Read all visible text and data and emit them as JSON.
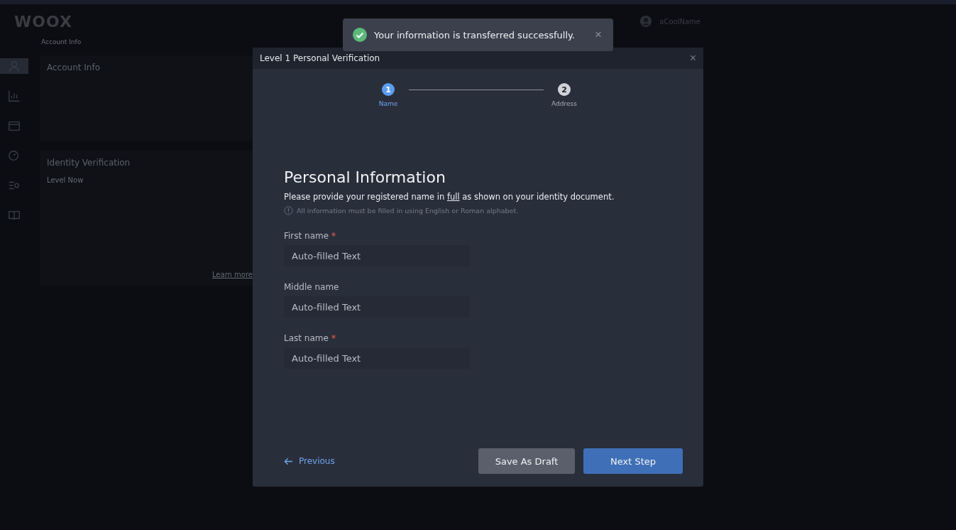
{
  "app": {
    "logo": "WOOX",
    "user": "aCoolName",
    "nav_tabs": [
      {
        "label": "Account Info",
        "selected": true
      }
    ],
    "sidebar_icons": [
      {
        "kind": "user",
        "selected": true
      },
      {
        "kind": "chart",
        "selected": false
      },
      {
        "kind": "wallet",
        "selected": false
      },
      {
        "kind": "gauge",
        "selected": false
      },
      {
        "kind": "list",
        "selected": false
      },
      {
        "kind": "book",
        "selected": false
      }
    ],
    "account_heading": "Account Info",
    "identity_heading": "Identity Verification",
    "level_label": "Level Now",
    "learn_more": "Learn more"
  },
  "toast": {
    "message": "Your information is transferred successfully.",
    "close": "×"
  },
  "dialog": {
    "title": "Level 1 Personal Verification",
    "close": "×",
    "steps": [
      {
        "number": "1",
        "label": "Name",
        "selected": true
      },
      {
        "number": "2",
        "label": "Address",
        "selected": false
      }
    ],
    "heading": "Personal Information",
    "instruction": {
      "before": "Please provide your registered name in",
      "link": "full",
      "after": "as shown on your identity document."
    },
    "note": "All information must be filled in using English or Roman alphabet.",
    "fields": [
      {
        "label": "First name",
        "required": true,
        "value": "Auto-filled Text"
      },
      {
        "label": "Middle name",
        "required": false,
        "value": "Auto-filled Text"
      },
      {
        "label": "Last name",
        "required": true,
        "value": "Auto-filled Text"
      }
    ],
    "previous": "Previous",
    "save_draft": "Save As Draft",
    "next": "Next Step"
  }
}
